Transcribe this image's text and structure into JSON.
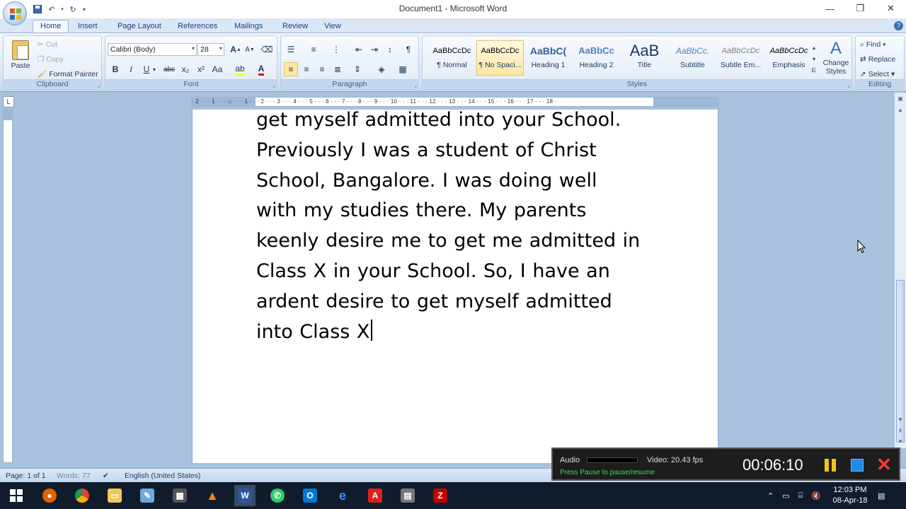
{
  "window": {
    "title": "Document1 - Microsoft Word",
    "controls": {
      "minimize": "—",
      "restore": "❐",
      "close": "✕"
    }
  },
  "quick_access": [
    "save-icon",
    "undo-icon",
    "redo-icon",
    "customize-icon"
  ],
  "tabs": [
    {
      "label": "Home",
      "active": true
    },
    {
      "label": "Insert"
    },
    {
      "label": "Page Layout"
    },
    {
      "label": "References"
    },
    {
      "label": "Mailings"
    },
    {
      "label": "Review"
    },
    {
      "label": "View"
    }
  ],
  "clipboard": {
    "label": "Clipboard",
    "paste": "Paste",
    "cut": "Cut",
    "copy": "Copy",
    "format_painter": "Format Painter"
  },
  "font": {
    "label": "Font",
    "family": "Calibri (Body)",
    "size": "28",
    "grow": "A",
    "shrink": "A",
    "bold": "B",
    "italic": "I",
    "underline": "U",
    "strike": "abc",
    "subscript": "x₂",
    "superscript": "x²",
    "change_case": "Aa",
    "font_color": "A"
  },
  "paragraph": {
    "label": "Paragraph"
  },
  "styles": {
    "label": "Styles",
    "items": [
      {
        "sample": "AaBbCcDc",
        "name": "¶ Normal"
      },
      {
        "sample": "AaBbCcDc",
        "name": "¶ No Spaci...",
        "selected": true
      },
      {
        "sample": "AaBbC(",
        "name": "Heading 1"
      },
      {
        "sample": "AaBbCc",
        "name": "Heading 2"
      },
      {
        "sample": "AaB",
        "name": "Title"
      },
      {
        "sample": "AaBbCc.",
        "name": "Subtitle"
      },
      {
        "sample": "AaBbCcDc",
        "name": "Subtle Em..."
      },
      {
        "sample": "AaBbCcDc",
        "name": "Emphasis"
      }
    ],
    "change_styles": "Change Styles"
  },
  "editing": {
    "label": "Editing",
    "find": "Find",
    "replace": "Replace",
    "select": "Select"
  },
  "ruler": {
    "ticks": "· 2 · · · 1 · · · ⌂ · · · 1 · · · 2 · · · 3 · · · 4 · · · 5 · · · 6 · · · 7 · · · 8 · · · 9 · · · 10 · · · 11 · · · 12 · · · 13 · · · 14 · · · 15 · · · 16 · · · 17 · · · 18 ·"
  },
  "document": {
    "lines": [
      "get myself admitted into your School.",
      "Previously I was a student of Christ",
      "School, Bangalore. I was doing well",
      "with my studies there. My parents",
      "keenly desire me to get me admitted in",
      "Class X in your School. So, I have an",
      "ardent desire to get myself admitted",
      "into Class X"
    ]
  },
  "status": {
    "page": "Page: 1 of 1",
    "words": "Words: 77",
    "language": "English (United States)"
  },
  "recorder": {
    "audio": "Audio",
    "video": "Video: 20.43 fps",
    "hint": "Press Pause to pause/resume",
    "time": "00:06:10"
  },
  "taskbar": {
    "apps": [
      "windows-start",
      "firefox",
      "chrome",
      "file-explorer",
      "notepad",
      "calculator",
      "vlc",
      "word",
      "whatsapp",
      "outlook",
      "edge",
      "acrobat",
      "calculator-2",
      "filezilla"
    ],
    "clock_time": "12:03 PM",
    "clock_date": "08-Apr-18"
  },
  "colors": {
    "ribbon_bg": "#dbe7f5",
    "workspace_bg": "#a8c1dc",
    "taskbar_bg": "#101c2c",
    "recorder_hint": "#3fd94a"
  }
}
